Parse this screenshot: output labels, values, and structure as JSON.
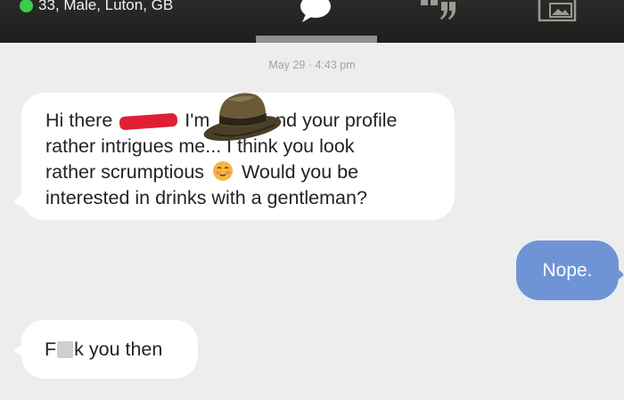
{
  "header": {
    "status_text": "33, Male, Luton, GB",
    "online_color": "#3ecb4f",
    "tabs": [
      {
        "icon": "chat-bubble-icon",
        "active": true
      },
      {
        "icon": "quote-icon",
        "active": false
      },
      {
        "icon": "photos-icon",
        "active": false
      }
    ]
  },
  "conversation": {
    "timestamp": "May 29 · 4:43 pm",
    "messages": [
      {
        "direction": "incoming",
        "line1_start": "Hi there",
        "line1_mid": "I'm",
        "line1_end": "and your profile",
        "line2_start": "rather intrigues me... ",
        "line2_end": "I think you look",
        "line3_start": "rather scrumptious",
        "line3_end": "Would you be",
        "line4": "interested in drinks with a gentleman?"
      },
      {
        "direction": "outgoing",
        "text": "Nope."
      },
      {
        "direction": "incoming",
        "text_start": "F",
        "text_end": "k you then"
      }
    ]
  },
  "colors": {
    "outgoing_bubble": "#6f94d6",
    "incoming_bubble": "#ffffff",
    "redaction": "#e01f35"
  }
}
